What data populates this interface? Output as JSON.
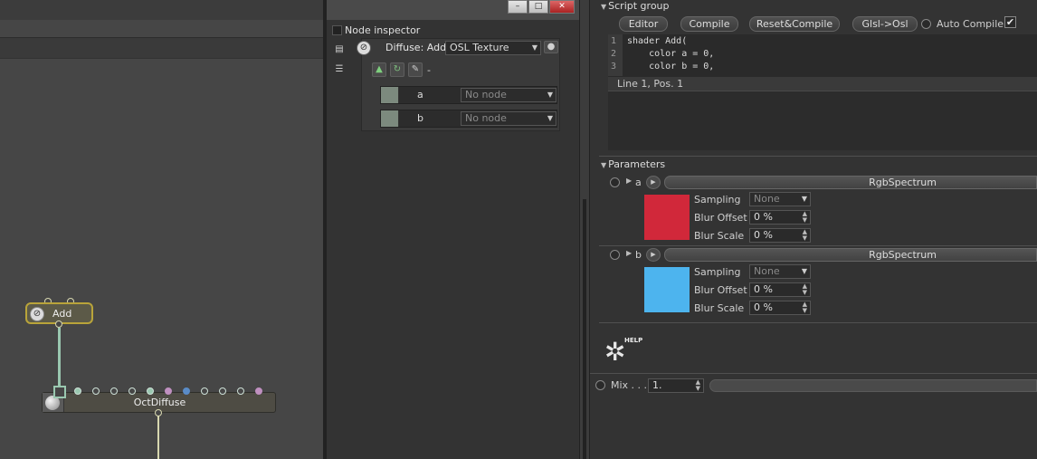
{
  "node_editor": {
    "nodes": {
      "add_label": "Add",
      "octdiffuse_label": "OctDiffuse"
    }
  },
  "window_buttons": [
    "–",
    "□",
    "✕"
  ],
  "inspector": {
    "title": "Node inspector",
    "node_title": "Diffuse: Add",
    "node_type": "OSL Texture",
    "dash": "-",
    "inputs": [
      {
        "name": "a",
        "value": "No node"
      },
      {
        "name": "b",
        "value": "No node"
      }
    ]
  },
  "script_group": {
    "header": "Script group",
    "buttons": [
      "Editor",
      "Compile",
      "Reset&Compile",
      "Glsl->Osl"
    ],
    "auto_compile_label": "Auto Compile",
    "auto_compile_checked": true,
    "code_lines": [
      {
        "n": "1",
        "text": "shader Add("
      },
      {
        "n": "2",
        "text": "    color a = 0,"
      },
      {
        "n": "3",
        "text": "    color b = 0,"
      }
    ],
    "status": "Line 1, Pos. 1"
  },
  "parameters": {
    "header": "Parameters",
    "params": [
      {
        "name": "a",
        "type": "RgbSpectrum",
        "color": "#d1283a",
        "sampling_label": "Sampling",
        "sampling_value": "None",
        "blur_offset_label": "Blur Offset",
        "blur_offset_value": "0 %",
        "blur_scale_label": "Blur Scale",
        "blur_scale_value": "0 %"
      },
      {
        "name": "b",
        "type": "RgbSpectrum",
        "color": "#4db4ee",
        "sampling_label": "Sampling",
        "sampling_value": "None",
        "blur_offset_label": "Blur Offset",
        "blur_offset_value": "0 %",
        "blur_scale_label": "Blur Scale",
        "blur_scale_value": "0 %"
      }
    ]
  },
  "help": {
    "label": "HELP"
  },
  "mix": {
    "label": "Mix . . .",
    "value": "1."
  },
  "colors": {
    "accent_wire": "#9ac8b0",
    "selected_node_border": "#b9a43a"
  }
}
